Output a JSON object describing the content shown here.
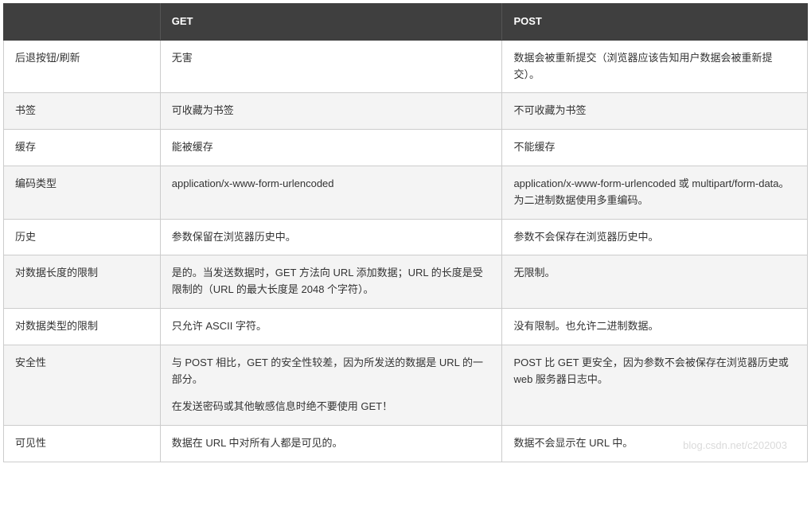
{
  "headers": {
    "col1": "",
    "col2": "GET",
    "col3": "POST"
  },
  "rows": [
    {
      "label": "后退按钮/刷新",
      "get": "无害",
      "post": "数据会被重新提交（浏览器应该告知用户数据会被重新提交）。"
    },
    {
      "label": "书签",
      "get": "可收藏为书签",
      "post": "不可收藏为书签"
    },
    {
      "label": "缓存",
      "get": "能被缓存",
      "post": "不能缓存"
    },
    {
      "label": "编码类型",
      "get": "application/x-www-form-urlencoded",
      "post": "application/x-www-form-urlencoded 或 multipart/form-data。为二进制数据使用多重编码。"
    },
    {
      "label": "历史",
      "get": "参数保留在浏览器历史中。",
      "post": "参数不会保存在浏览器历史中。"
    },
    {
      "label": "对数据长度的限制",
      "get": "是的。当发送数据时，GET 方法向 URL 添加数据；URL 的长度是受限制的（URL 的最大长度是 2048 个字符）。",
      "post": "无限制。"
    },
    {
      "label": "对数据类型的限制",
      "get": "只允许 ASCII 字符。",
      "post": "没有限制。也允许二进制数据。"
    },
    {
      "label": "安全性",
      "get": "与 POST 相比，GET 的安全性较差，因为所发送的数据是 URL 的一部分。",
      "get2": "在发送密码或其他敏感信息时绝不要使用 GET！",
      "post": "POST 比 GET 更安全，因为参数不会被保存在浏览器历史或 web 服务器日志中。"
    },
    {
      "label": "可见性",
      "get": "数据在 URL 中对所有人都是可见的。",
      "post": "数据不会显示在 URL 中。"
    }
  ],
  "watermark": "blog.csdn.net/c202003"
}
